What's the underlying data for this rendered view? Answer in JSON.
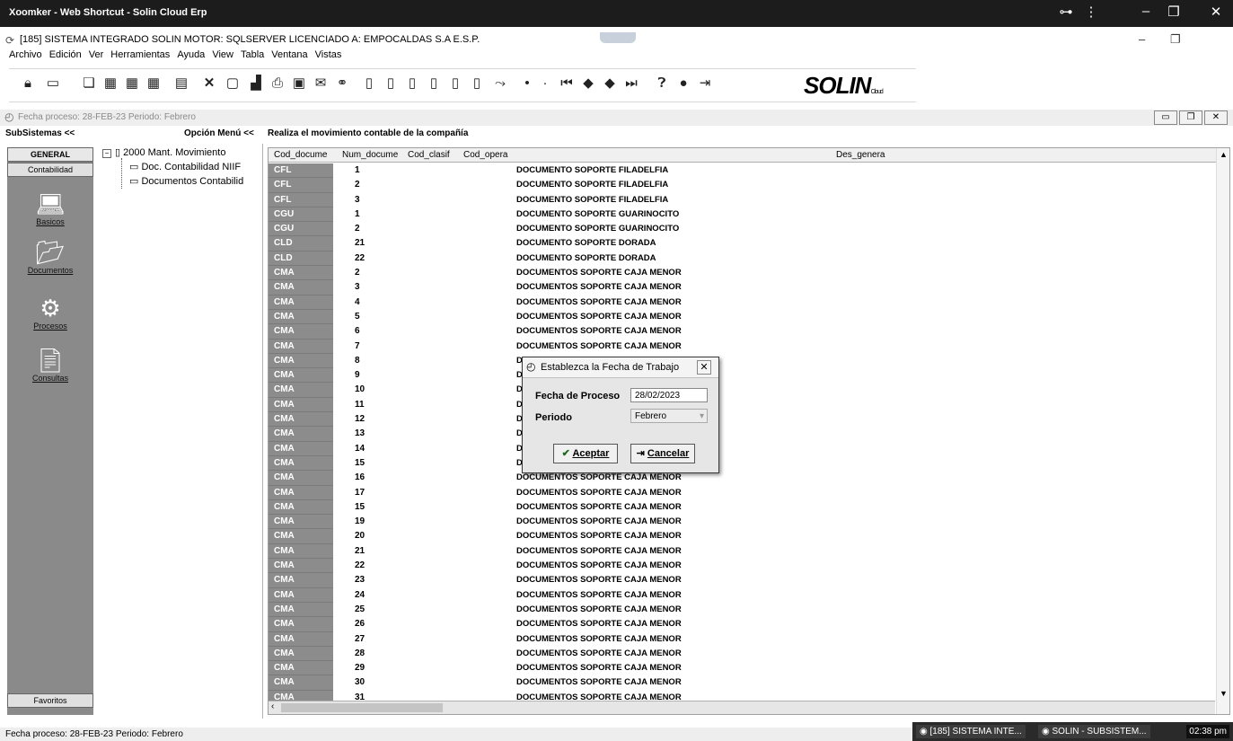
{
  "browser": {
    "title": "Xoomker - Web Shortcut - Solin Cloud Erp",
    "key_icon": "key-icon",
    "menu_icon": "kebab-menu-icon"
  },
  "app": {
    "title": "[185] SISTEMA INTEGRADO SOLIN MOTOR: SQLSERVER LICENCIADO A: EMPOCALDAS S.A E.S.P.",
    "logo": "SOLIN",
    "logo_sub": "Cloud"
  },
  "menu": [
    "Archivo",
    "Edición",
    "Ver",
    "Herramientas",
    "Ayuda",
    "View",
    "Tabla",
    "Ventana",
    "Vistas"
  ],
  "info_line": "Fecha proceso: 28-FEB-23 Periodo: Febrero",
  "header": {
    "subsistemas": "SubSistemas <<",
    "opcion_menu": "Opción Menú <<",
    "description": "Realiza el movimiento contable de la compañía"
  },
  "subsystems": {
    "general": "GENERAL",
    "contabilidad": "Contabilidad",
    "items": [
      {
        "label": "Basicos",
        "icon": "laptop-icon"
      },
      {
        "label": "Documentos",
        "icon": "documents-icon"
      },
      {
        "label": "Procesos",
        "icon": "gears-icon"
      },
      {
        "label": "Consultas",
        "icon": "search-document-icon"
      }
    ],
    "favoritos": "Favoritos"
  },
  "tree": {
    "root": "2000  Mant. Movimiento",
    "children": [
      "Doc. Contabilidad NIIF",
      "Documentos Contabilid"
    ]
  },
  "grid": {
    "columns": [
      "Cod_docume",
      "Num_docume",
      "Cod_clasif",
      "Cod_opera",
      "Des_genera"
    ],
    "rows": [
      [
        "CFL",
        "1",
        "DOCUMENTO SOPORTE FILADELFIA"
      ],
      [
        "CFL",
        "2",
        "DOCUMENTO SOPORTE FILADELFIA"
      ],
      [
        "CFL",
        "3",
        "DOCUMENTO SOPORTE FILADELFIA"
      ],
      [
        "CGU",
        "1",
        "DOCUMENTO SOPORTE GUARINOCITO"
      ],
      [
        "CGU",
        "2",
        "DOCUMENTO SOPORTE GUARINOCITO"
      ],
      [
        "CLD",
        "21",
        "DOCUMENTO SOPORTE DORADA"
      ],
      [
        "CLD",
        "22",
        "DOCUMENTO SOPORTE DORADA"
      ],
      [
        "CMA",
        "2",
        "DOCUMENTOS SOPORTE CAJA MENOR"
      ],
      [
        "CMA",
        "3",
        "DOCUMENTOS SOPORTE CAJA MENOR"
      ],
      [
        "CMA",
        "4",
        "DOCUMENTOS SOPORTE CAJA MENOR"
      ],
      [
        "CMA",
        "5",
        "DOCUMENTOS SOPORTE CAJA MENOR"
      ],
      [
        "CMA",
        "6",
        "DOCUMENTOS SOPORTE CAJA MENOR"
      ],
      [
        "CMA",
        "7",
        "DOCUMENTOS SOPORTE CAJA MENOR"
      ],
      [
        "CMA",
        "8",
        "D"
      ],
      [
        "CMA",
        "9",
        "D"
      ],
      [
        "CMA",
        "10",
        "D"
      ],
      [
        "CMA",
        "11",
        "D"
      ],
      [
        "CMA",
        "12",
        "D"
      ],
      [
        "CMA",
        "13",
        "D"
      ],
      [
        "CMA",
        "14",
        "D"
      ],
      [
        "CMA",
        "15",
        "D"
      ],
      [
        "CMA",
        "16",
        "DOCUMENTOS SOPORTE CAJA MENOR"
      ],
      [
        "CMA",
        "17",
        "DOCUMENTOS SOPORTE CAJA MENOR"
      ],
      [
        "CMA",
        "15",
        "DOCUMENTOS SOPORTE CAJA MENOR"
      ],
      [
        "CMA",
        "19",
        "DOCUMENTOS SOPORTE CAJA MENOR"
      ],
      [
        "CMA",
        "20",
        "DOCUMENTOS SOPORTE CAJA MENOR"
      ],
      [
        "CMA",
        "21",
        "DOCUMENTOS SOPORTE CAJA MENOR"
      ],
      [
        "CMA",
        "22",
        "DOCUMENTOS SOPORTE CAJA MENOR"
      ],
      [
        "CMA",
        "23",
        "DOCUMENTOS SOPORTE CAJA MENOR"
      ],
      [
        "CMA",
        "24",
        "DOCUMENTOS SOPORTE CAJA MENOR"
      ],
      [
        "CMA",
        "25",
        "DOCUMENTOS SOPORTE CAJA MENOR"
      ],
      [
        "CMA",
        "26",
        "DOCUMENTOS SOPORTE CAJA MENOR"
      ],
      [
        "CMA",
        "27",
        "DOCUMENTOS SOPORTE CAJA MENOR"
      ],
      [
        "CMA",
        "28",
        "DOCUMENTOS SOPORTE CAJA MENOR"
      ],
      [
        "CMA",
        "29",
        "DOCUMENTOS SOPORTE CAJA MENOR"
      ],
      [
        "CMA",
        "30",
        "DOCUMENTOS SOPORTE CAJA MENOR"
      ],
      [
        "CMA",
        "31",
        "DOCUMENTOS SOPORTE CAJA MENOR"
      ]
    ]
  },
  "dialog": {
    "title": "Establezca la Fecha de Trabajo",
    "fecha_label": "Fecha de Proceso",
    "fecha_value": "28/02/2023",
    "periodo_label": "Periodo",
    "periodo_value": "Febrero",
    "accept": "Aceptar",
    "cancel": "Cancelar"
  },
  "status": "Fecha proceso: 28-FEB-23 Periodo: Febrero",
  "taskbar": {
    "items": [
      "[185] SISTEMA INTE...",
      "SOLIN - SUBSISTEM..."
    ],
    "clock": "02:38 pm"
  }
}
